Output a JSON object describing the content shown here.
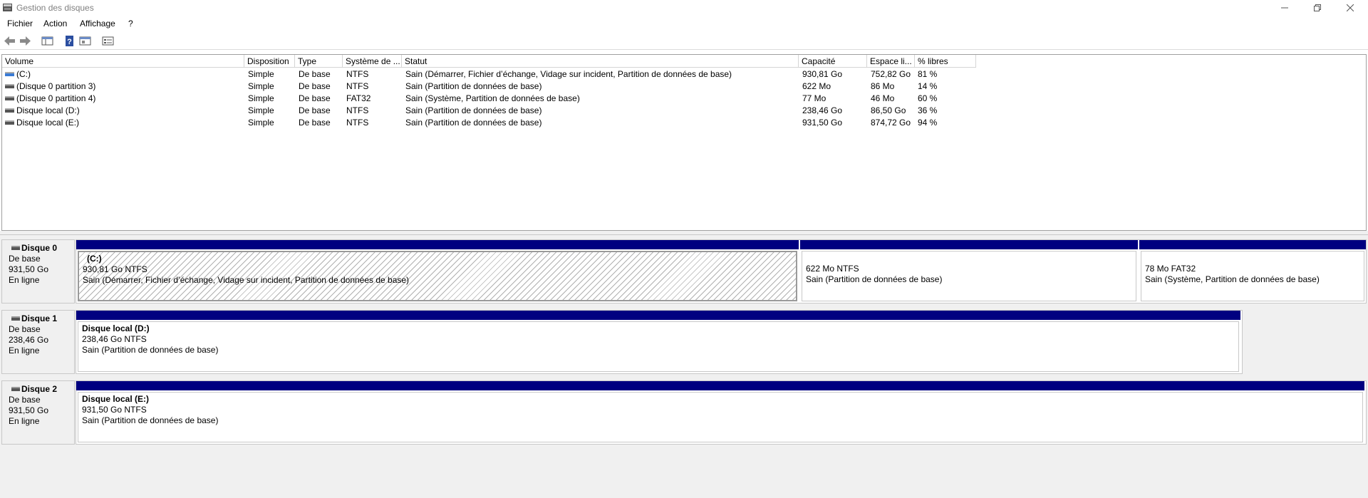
{
  "window": {
    "title": "Gestion des disques"
  },
  "menu": [
    "Fichier",
    "Action",
    "Affichage",
    "?"
  ],
  "volume_list": {
    "columns": [
      "Volume",
      "Disposition",
      "Type",
      "Système de ...",
      "Statut",
      "Capacité",
      "Espace li...",
      "% libres"
    ],
    "rows": [
      {
        "volume": "(C:)",
        "disposition": "Simple",
        "type": "De base",
        "fs": "NTFS",
        "status": "Sain (Démarrer, Fichier d’échange, Vidage sur incident, Partition de données de base)",
        "capacity": "930,81 Go",
        "free": "752,82 Go",
        "pct": "81 %",
        "icon": "blue-volume-icon"
      },
      {
        "volume": "(Disque 0 partition 3)",
        "disposition": "Simple",
        "type": "De base",
        "fs": "NTFS",
        "status": "Sain (Partition de données de base)",
        "capacity": "622 Mo",
        "free": "86 Mo",
        "pct": "14 %",
        "icon": "volume-icon"
      },
      {
        "volume": "(Disque 0 partition 4)",
        "disposition": "Simple",
        "type": "De base",
        "fs": "FAT32",
        "status": "Sain (Système, Partition de données de base)",
        "capacity": "77 Mo",
        "free": "46 Mo",
        "pct": "60 %",
        "icon": "volume-icon"
      },
      {
        "volume": "Disque local (D:)",
        "disposition": "Simple",
        "type": "De base",
        "fs": "NTFS",
        "status": "Sain (Partition de données de base)",
        "capacity": "238,46 Go",
        "free": "86,50 Go",
        "pct": "36 %",
        "icon": "volume-icon"
      },
      {
        "volume": "Disque local (E:)",
        "disposition": "Simple",
        "type": "De base",
        "fs": "NTFS",
        "status": "Sain (Partition de données de base)",
        "capacity": "931,50 Go",
        "free": "874,72 Go",
        "pct": "94 %",
        "icon": "volume-icon"
      }
    ]
  },
  "disks": [
    {
      "name": "Disque 0",
      "type": "De base",
      "size": "931,50 Go",
      "state": "En ligne",
      "partitions": [
        {
          "label": "(C:)",
          "size": "930,81 Go NTFS",
          "status": "Sain (Démarrer, Fichier d’échange, Vidage sur incident, Partition de données de base)"
        },
        {
          "label": "",
          "size": "622 Mo NTFS",
          "status": "Sain (Partition de données de base)"
        },
        {
          "label": "",
          "size": "78 Mo FAT32",
          "status": "Sain (Système, Partition de données de base)"
        }
      ]
    },
    {
      "name": "Disque 1",
      "type": "De base",
      "size": "238,46 Go",
      "state": "En ligne",
      "partitions": [
        {
          "label": "Disque local  (D:)",
          "size": "238,46 Go NTFS",
          "status": "Sain (Partition de données de base)"
        }
      ]
    },
    {
      "name": "Disque 2",
      "type": "De base",
      "size": "931,50 Go",
      "state": "En ligne",
      "partitions": [
        {
          "label": "Disque local  (E:)",
          "size": "931,50 Go NTFS",
          "status": "Sain (Partition de données de base)"
        }
      ]
    }
  ],
  "colors": {
    "partition_bar": "#000080",
    "selection_hatch": "#b0b0b0"
  }
}
